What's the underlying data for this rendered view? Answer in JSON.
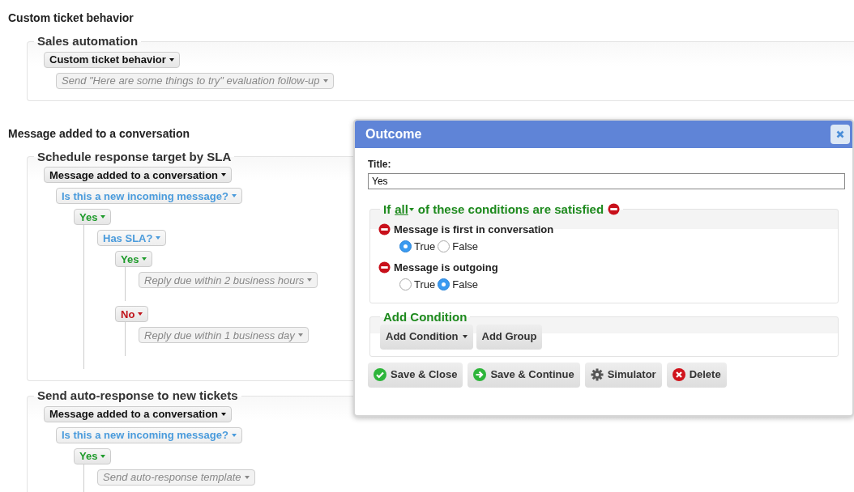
{
  "sections": [
    {
      "heading": "Custom ticket behavior",
      "rules": [
        {
          "title": "Sales automation",
          "tree": [
            {
              "kind": "trigger",
              "label": "Custom ticket behavior",
              "children": [
                {
                  "kind": "action",
                  "label": "Send \"Here are some things to try\" evaluation follow-up"
                }
              ]
            }
          ]
        }
      ]
    },
    {
      "heading": "Message added to a conversation",
      "rules": [
        {
          "title": "Schedule response target by SLA",
          "tree": [
            {
              "kind": "trigger",
              "label": "Message added to a conversation",
              "children": [
                {
                  "kind": "condition",
                  "label": "Is this a new incoming message?",
                  "children": [
                    {
                      "kind": "yes",
                      "label": "Yes",
                      "children": [
                        {
                          "kind": "condition",
                          "label": "Has SLA?",
                          "children": [
                            {
                              "kind": "yes",
                              "label": "Yes",
                              "children": [
                                {
                                  "kind": "action",
                                  "label": "Reply due within 2 business hours"
                                }
                              ]
                            },
                            {
                              "kind": "no",
                              "label": "No",
                              "children": [
                                {
                                  "kind": "action",
                                  "label": "Reply due within 1 business day"
                                }
                              ]
                            }
                          ]
                        }
                      ]
                    }
                  ]
                }
              ]
            }
          ]
        },
        {
          "title": "Send auto-response to new tickets",
          "tree": [
            {
              "kind": "trigger",
              "label": "Message added to a conversation",
              "children": [
                {
                  "kind": "condition",
                  "label": "Is this a new incoming message?",
                  "children": [
                    {
                      "kind": "yes",
                      "label": "Yes",
                      "children": [
                        {
                          "kind": "action",
                          "label": "Send auto-response template"
                        }
                      ]
                    }
                  ]
                }
              ]
            }
          ]
        }
      ]
    }
  ],
  "dialog": {
    "title": "Outcome",
    "title_label": "Title:",
    "title_value": "Yes",
    "condition_group": {
      "prefix": "If",
      "quantifier": "all",
      "suffix": "of these conditions are satisfied",
      "conditions": [
        {
          "label": "Message is first in conversation",
          "options": [
            {
              "label": "True",
              "selected": true
            },
            {
              "label": "False",
              "selected": false
            }
          ]
        },
        {
          "label": "Message is outgoing",
          "options": [
            {
              "label": "True",
              "selected": false
            },
            {
              "label": "False",
              "selected": true
            }
          ]
        }
      ]
    },
    "add_section": {
      "legend": "Add Condition",
      "buttons": [
        {
          "kind": "dropdown",
          "label": "Add Condition"
        },
        {
          "kind": "plain",
          "label": "Add Group"
        }
      ]
    },
    "actions": [
      {
        "kind": "save-close",
        "label": "Save & Close"
      },
      {
        "kind": "save-continue",
        "label": "Save & Continue"
      },
      {
        "kind": "simulator",
        "label": "Simulator"
      },
      {
        "kind": "delete",
        "label": "Delete"
      }
    ]
  }
}
